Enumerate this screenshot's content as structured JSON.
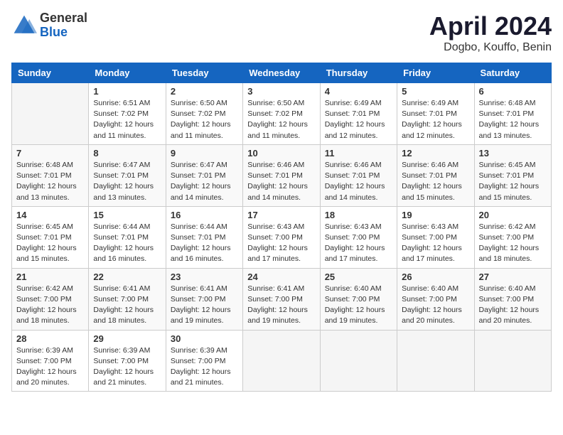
{
  "logo": {
    "general": "General",
    "blue": "Blue"
  },
  "title": {
    "month": "April 2024",
    "location": "Dogbo, Kouffo, Benin"
  },
  "weekdays": [
    "Sunday",
    "Monday",
    "Tuesday",
    "Wednesday",
    "Thursday",
    "Friday",
    "Saturday"
  ],
  "weeks": [
    [
      {
        "day": "",
        "info": ""
      },
      {
        "day": "1",
        "info": "Sunrise: 6:51 AM\nSunset: 7:02 PM\nDaylight: 12 hours\nand 11 minutes."
      },
      {
        "day": "2",
        "info": "Sunrise: 6:50 AM\nSunset: 7:02 PM\nDaylight: 12 hours\nand 11 minutes."
      },
      {
        "day": "3",
        "info": "Sunrise: 6:50 AM\nSunset: 7:02 PM\nDaylight: 12 hours\nand 11 minutes."
      },
      {
        "day": "4",
        "info": "Sunrise: 6:49 AM\nSunset: 7:01 PM\nDaylight: 12 hours\nand 12 minutes."
      },
      {
        "day": "5",
        "info": "Sunrise: 6:49 AM\nSunset: 7:01 PM\nDaylight: 12 hours\nand 12 minutes."
      },
      {
        "day": "6",
        "info": "Sunrise: 6:48 AM\nSunset: 7:01 PM\nDaylight: 12 hours\nand 13 minutes."
      }
    ],
    [
      {
        "day": "7",
        "info": "Sunrise: 6:48 AM\nSunset: 7:01 PM\nDaylight: 12 hours\nand 13 minutes."
      },
      {
        "day": "8",
        "info": "Sunrise: 6:47 AM\nSunset: 7:01 PM\nDaylight: 12 hours\nand 13 minutes."
      },
      {
        "day": "9",
        "info": "Sunrise: 6:47 AM\nSunset: 7:01 PM\nDaylight: 12 hours\nand 14 minutes."
      },
      {
        "day": "10",
        "info": "Sunrise: 6:46 AM\nSunset: 7:01 PM\nDaylight: 12 hours\nand 14 minutes."
      },
      {
        "day": "11",
        "info": "Sunrise: 6:46 AM\nSunset: 7:01 PM\nDaylight: 12 hours\nand 14 minutes."
      },
      {
        "day": "12",
        "info": "Sunrise: 6:46 AM\nSunset: 7:01 PM\nDaylight: 12 hours\nand 15 minutes."
      },
      {
        "day": "13",
        "info": "Sunrise: 6:45 AM\nSunset: 7:01 PM\nDaylight: 12 hours\nand 15 minutes."
      }
    ],
    [
      {
        "day": "14",
        "info": "Sunrise: 6:45 AM\nSunset: 7:01 PM\nDaylight: 12 hours\nand 15 minutes."
      },
      {
        "day": "15",
        "info": "Sunrise: 6:44 AM\nSunset: 7:01 PM\nDaylight: 12 hours\nand 16 minutes."
      },
      {
        "day": "16",
        "info": "Sunrise: 6:44 AM\nSunset: 7:01 PM\nDaylight: 12 hours\nand 16 minutes."
      },
      {
        "day": "17",
        "info": "Sunrise: 6:43 AM\nSunset: 7:00 PM\nDaylight: 12 hours\nand 17 minutes."
      },
      {
        "day": "18",
        "info": "Sunrise: 6:43 AM\nSunset: 7:00 PM\nDaylight: 12 hours\nand 17 minutes."
      },
      {
        "day": "19",
        "info": "Sunrise: 6:43 AM\nSunset: 7:00 PM\nDaylight: 12 hours\nand 17 minutes."
      },
      {
        "day": "20",
        "info": "Sunrise: 6:42 AM\nSunset: 7:00 PM\nDaylight: 12 hours\nand 18 minutes."
      }
    ],
    [
      {
        "day": "21",
        "info": "Sunrise: 6:42 AM\nSunset: 7:00 PM\nDaylight: 12 hours\nand 18 minutes."
      },
      {
        "day": "22",
        "info": "Sunrise: 6:41 AM\nSunset: 7:00 PM\nDaylight: 12 hours\nand 18 minutes."
      },
      {
        "day": "23",
        "info": "Sunrise: 6:41 AM\nSunset: 7:00 PM\nDaylight: 12 hours\nand 19 minutes."
      },
      {
        "day": "24",
        "info": "Sunrise: 6:41 AM\nSunset: 7:00 PM\nDaylight: 12 hours\nand 19 minutes."
      },
      {
        "day": "25",
        "info": "Sunrise: 6:40 AM\nSunset: 7:00 PM\nDaylight: 12 hours\nand 19 minutes."
      },
      {
        "day": "26",
        "info": "Sunrise: 6:40 AM\nSunset: 7:00 PM\nDaylight: 12 hours\nand 20 minutes."
      },
      {
        "day": "27",
        "info": "Sunrise: 6:40 AM\nSunset: 7:00 PM\nDaylight: 12 hours\nand 20 minutes."
      }
    ],
    [
      {
        "day": "28",
        "info": "Sunrise: 6:39 AM\nSunset: 7:00 PM\nDaylight: 12 hours\nand 20 minutes."
      },
      {
        "day": "29",
        "info": "Sunrise: 6:39 AM\nSunset: 7:00 PM\nDaylight: 12 hours\nand 21 minutes."
      },
      {
        "day": "30",
        "info": "Sunrise: 6:39 AM\nSunset: 7:00 PM\nDaylight: 12 hours\nand 21 minutes."
      },
      {
        "day": "",
        "info": ""
      },
      {
        "day": "",
        "info": ""
      },
      {
        "day": "",
        "info": ""
      },
      {
        "day": "",
        "info": ""
      }
    ]
  ]
}
